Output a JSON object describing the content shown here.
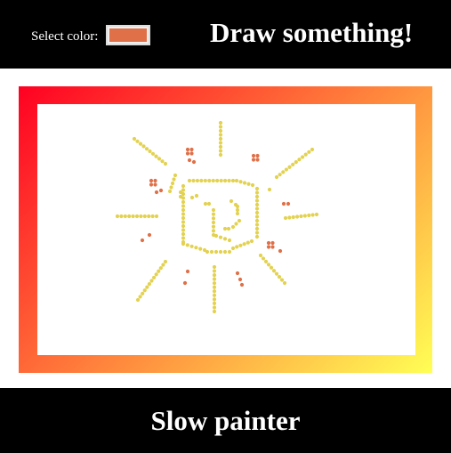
{
  "header": {
    "color_label": "Select color:",
    "selected_color": "#e07048",
    "title": "Draw something!"
  },
  "frame": {
    "gradient_start": "#ff0022",
    "gradient_end": "#ffff55"
  },
  "drawing": {
    "yellow": "#e3d250",
    "orange": "#e07048"
  },
  "footer": {
    "title": "Slow painter"
  }
}
